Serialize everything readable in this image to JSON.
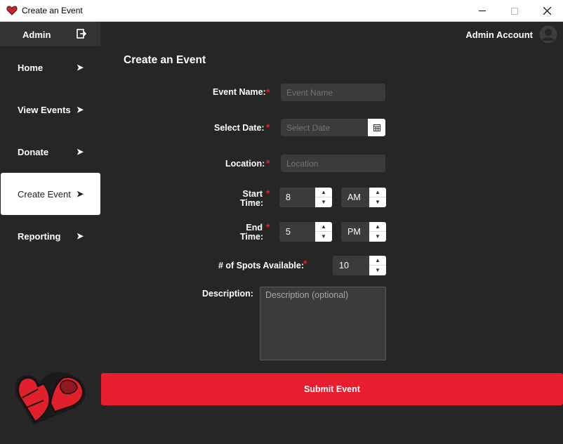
{
  "window": {
    "title": "Create an Event"
  },
  "sidebar": {
    "header_label": "Admin",
    "items": [
      {
        "label": "Home",
        "active": false
      },
      {
        "label": "View Events",
        "active": false
      },
      {
        "label": "Donate",
        "active": false
      },
      {
        "label": "Create Event",
        "active": true
      },
      {
        "label": "Reporting",
        "active": false
      }
    ],
    "chevron": "➤"
  },
  "header": {
    "account_label": "Admin Account"
  },
  "form": {
    "title": "Create an Event",
    "required_mark": "*",
    "event_name": {
      "label": "Event Name:",
      "placeholder": "Event Name",
      "value": ""
    },
    "date": {
      "label": "Select Date:",
      "placeholder": "Select Date",
      "value": ""
    },
    "location": {
      "label": "Location:",
      "placeholder": "Location",
      "value": ""
    },
    "start_time": {
      "label_line1": "Start",
      "label_line2": "Time:",
      "hour": "8",
      "period": "AM"
    },
    "end_time": {
      "label_line1": "End",
      "label_line2": "Time:",
      "hour": "5",
      "period": "PM"
    },
    "spots": {
      "label": "# of Spots Available:",
      "value": "10"
    },
    "description": {
      "label": "Description:",
      "placeholder": "Description (optional)",
      "value": ""
    },
    "submit_label": "Submit Event",
    "spin_up": "▲",
    "spin_down": "▼"
  },
  "colors": {
    "accent": "#e81e2e",
    "background": "#262626",
    "input": "#3b3b3b"
  }
}
